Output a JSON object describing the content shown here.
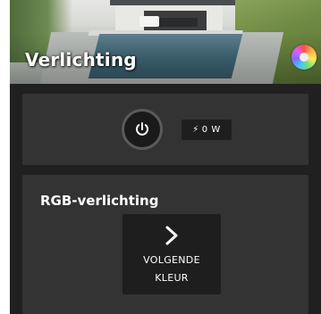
{
  "header": {
    "title": "Verlichting",
    "image_icon": "garden-pool-photo",
    "palette_icon": "color-palette-icon"
  },
  "power": {
    "icon": "power-icon",
    "power_reading": "0 W",
    "bolt_icon": "bolt-icon"
  },
  "rgb": {
    "title": "RGB-verlichting",
    "next_button": {
      "icon": "chevron-right-icon",
      "label": "VOLGENDE\nKLEUR"
    }
  },
  "colors": {
    "background": "#202020",
    "card": "#333333",
    "button": "#1e1e1e",
    "text": "#ffffff"
  }
}
